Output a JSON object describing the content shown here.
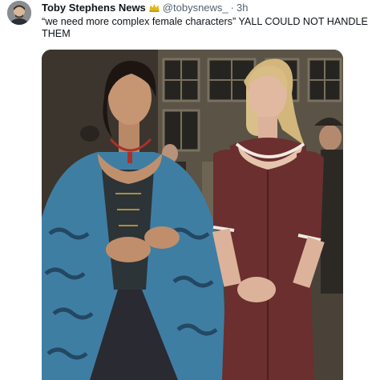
{
  "tweet": {
    "author_name": "Toby Stephens News",
    "handle": "@tobysnews_",
    "separator": "·",
    "time": "3h",
    "text": "“we need more complex female characters” YALL COULD NOT HANDLE THEM",
    "verified_icon": "gold-crown-badge-icon"
  },
  "media": {
    "kind": "photo",
    "palette": {
      "background": "#4a4238",
      "door": "#5b5346",
      "left_robe": "#3f7ea3",
      "right_dress": "#6a2f2e"
    }
  }
}
